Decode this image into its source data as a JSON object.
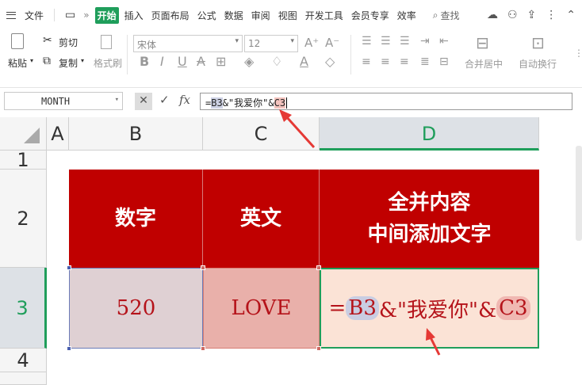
{
  "menu": {
    "file_label": "文件",
    "tabs": [
      "开始",
      "插入",
      "页面布局",
      "公式",
      "数据",
      "审阅",
      "视图",
      "开发工具",
      "会员专享",
      "效率"
    ],
    "search_label": "查找"
  },
  "ribbon": {
    "paste_label": "粘贴",
    "cut_label": "剪切",
    "copy_label": "复制",
    "format_painter_label": "格式刷",
    "font_name": "宋体",
    "font_size": "12",
    "merge_label": "合并居中",
    "wrap_label": "自动换行"
  },
  "formula_bar": {
    "name_box": "MONTH",
    "fx_label": "fx",
    "formula_prefix": "=",
    "formula_ref1": "B3",
    "formula_mid": "&\"我爱你\"&",
    "formula_ref2": "C3"
  },
  "columns": [
    "A",
    "B",
    "C",
    "D"
  ],
  "rows": [
    "1",
    "2",
    "3",
    "4"
  ],
  "table": {
    "header_b": "数字",
    "header_c": "英文",
    "header_d_line1": "全并内容",
    "header_d_line2": "中间添加文字",
    "value_b": "520",
    "value_c": "LOVE",
    "edit_prefix": "=",
    "edit_ref1": "B3",
    "edit_mid": "&\"我爱你\"&",
    "edit_ref2": "C3"
  },
  "colors": {
    "accent": "#1f9e5b",
    "header_fill": "#c00000",
    "value_text": "#b5131a",
    "arrow": "#e53935"
  }
}
